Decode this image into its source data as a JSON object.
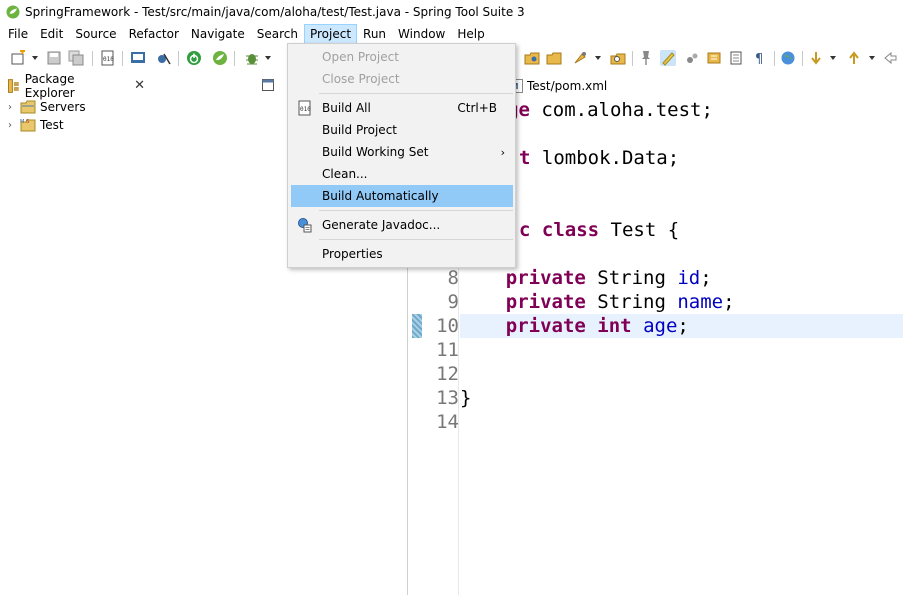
{
  "window": {
    "title": "SpringFramework - Test/src/main/java/com/aloha/test/Test.java - Spring Tool Suite 3"
  },
  "menubar": {
    "items": [
      "File",
      "Edit",
      "Source",
      "Refactor",
      "Navigate",
      "Search",
      "Project",
      "Run",
      "Window",
      "Help"
    ],
    "open_menu": "Project"
  },
  "project_menu": {
    "open_project": "Open Project",
    "close_project": "Close Project",
    "build_all": "Build All",
    "build_all_shortcut": "Ctrl+B",
    "build_project": "Build Project",
    "build_working_set": "Build Working Set",
    "clean": "Clean...",
    "build_automatically": "Build Automatically",
    "generate_javadoc": "Generate Javadoc...",
    "properties": "Properties"
  },
  "package_explorer": {
    "tab_label": "Package Explorer",
    "items": [
      "Servers",
      "Test"
    ]
  },
  "editor": {
    "tab_label": "Test/pom.xml",
    "lines": [
      {
        "n": "",
        "parts": [
          [
            "kw",
            "ge"
          ],
          [
            "",
            " com.aloha.test;"
          ]
        ]
      },
      {
        "n": "",
        "parts": [
          [
            "kw",
            "t"
          ],
          [
            "",
            " lombok.Data;"
          ]
        ]
      },
      {
        "n": "",
        "parts": [
          [
            "kw",
            "c"
          ],
          [
            "",
            " "
          ],
          [
            "kw",
            "class"
          ],
          [
            "",
            " Test {"
          ]
        ]
      },
      {
        "n": "8",
        "parts": [
          [
            "",
            "    "
          ],
          [
            "kw",
            "private"
          ],
          [
            "",
            " String "
          ],
          [
            "fld",
            "id"
          ],
          [
            "",
            ";"
          ]
        ]
      },
      {
        "n": "9",
        "parts": [
          [
            "",
            "    "
          ],
          [
            "kw",
            "private"
          ],
          [
            "",
            " String "
          ],
          [
            "fld",
            "name"
          ],
          [
            "",
            ";"
          ]
        ]
      },
      {
        "n": "10",
        "parts": [
          [
            "",
            "    "
          ],
          [
            "kw",
            "private"
          ],
          [
            "",
            " "
          ],
          [
            "kw",
            "int"
          ],
          [
            "",
            " "
          ],
          [
            "fld",
            "age"
          ],
          [
            "",
            ";"
          ]
        ]
      },
      {
        "n": "11",
        "parts": []
      },
      {
        "n": "12",
        "parts": []
      },
      {
        "n": "13",
        "parts": [
          [
            "",
            "}"
          ]
        ]
      },
      {
        "n": "14",
        "parts": []
      }
    ]
  },
  "colors": {
    "menu_highlight": "#91c9f7",
    "keyword": "#7f0055",
    "field": "#0000c0"
  }
}
